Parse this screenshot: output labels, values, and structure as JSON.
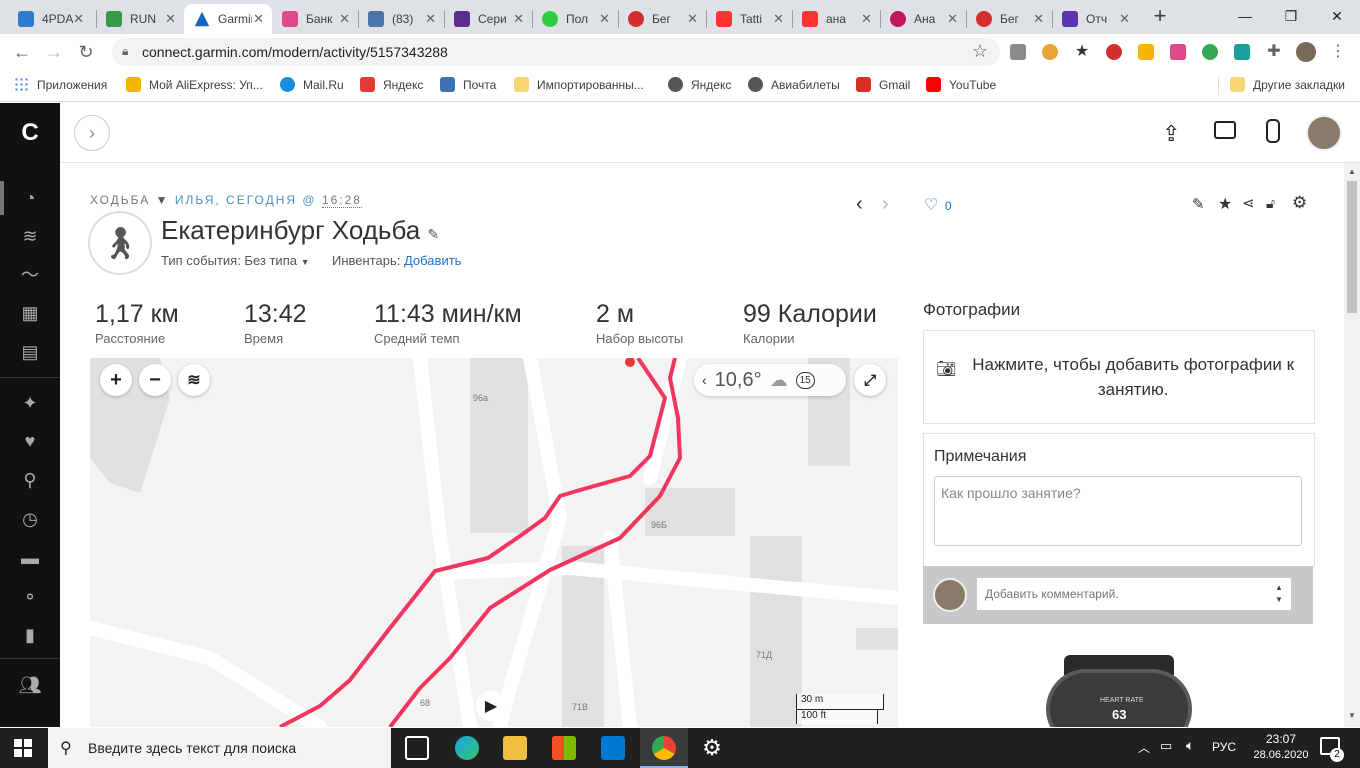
{
  "browser": {
    "tabs": [
      {
        "title": "4PDA",
        "color": "#2e7bcf"
      },
      {
        "title": "RUN",
        "color": "#3a9a4a"
      },
      {
        "title": "Garmin",
        "color": "#1565c0"
      },
      {
        "title": "Банк",
        "color": "#e04a8a"
      },
      {
        "title": "(83)",
        "color": "#4a76a8"
      },
      {
        "title": "Сери",
        "color": "#5b2d8f"
      },
      {
        "title": "Пол",
        "color": "#2ecc40"
      },
      {
        "title": "Бег",
        "color": "#d32f2f"
      },
      {
        "title": "Tatti",
        "color": "#ff3333"
      },
      {
        "title": "ана",
        "color": "#ff3333"
      },
      {
        "title": "Ана",
        "color": "#c2185b"
      },
      {
        "title": "Бег",
        "color": "#d32f2f"
      },
      {
        "title": "Отч",
        "color": "#5e35b1"
      }
    ],
    "close_glyph": "✕",
    "new_tab": "+",
    "url": "connect.garmin.com/modern/activity/5157343288",
    "bookmarks": [
      {
        "label": "Приложения",
        "color": "#4285f4"
      },
      {
        "label": "Мой AliExpress: Уп...",
        "color": "#f4b400"
      },
      {
        "label": "Mail.Ru",
        "color": "#168de2"
      },
      {
        "label": "Яндекс",
        "color": "#e53935"
      },
      {
        "label": "Почта",
        "color": "#3d6fb6"
      },
      {
        "label": "Импортированны...",
        "color": "#f7d774"
      },
      {
        "label": "Яндекс",
        "color": "#555555"
      },
      {
        "label": "Авиабилеты",
        "color": "#555555"
      },
      {
        "label": "Gmail",
        "color": "#d93025"
      },
      {
        "label": "YouTube",
        "color": "#ff0000"
      }
    ],
    "other_bookmarks": "Другие закладки"
  },
  "activity": {
    "type_label": "ХОДЬБА",
    "meta": "ИЛЬЯ, СЕГОДНЯ @",
    "time": "16:28",
    "title": "Екатеринбург Ходьба",
    "event_type": "Тип события: Без типа",
    "gear_label": "Инвентарь:",
    "gear_add": "Добавить",
    "likes": "0"
  },
  "stats": [
    {
      "value": "1,17 км",
      "label": "Расстояние"
    },
    {
      "value": "13:42",
      "label": "Время"
    },
    {
      "value": "11:43 мин/км",
      "label": "Средний темп"
    },
    {
      "value": "2 м",
      "label": "Набор высоты"
    },
    {
      "value": "99 Калории",
      "label": "Калории"
    }
  ],
  "map": {
    "temperature": "10,6°",
    "wind": "15",
    "scale_m": "30 m",
    "scale_ft": "100 ft",
    "building_labels": [
      "96а",
      "96Б",
      "71Д",
      "71В",
      "68"
    ]
  },
  "photos": {
    "title": "Фотографии",
    "prompt": "Нажмите, чтобы добавить фотографии к занятию."
  },
  "notes": {
    "title": "Примечания",
    "placeholder": "Как прошло занятие?"
  },
  "comment": {
    "placeholder": "Добавить комментарий."
  },
  "watch": {
    "label": "HEART RATE",
    "value": "63"
  },
  "taskbar": {
    "search_placeholder": "Введите здесь текст для поиска",
    "lang": "РУС",
    "time": "23:07",
    "date": "28.06.2020",
    "notifications": "2"
  },
  "colors": {
    "track": "#f0365e",
    "garmin_link": "#1a73c9"
  }
}
